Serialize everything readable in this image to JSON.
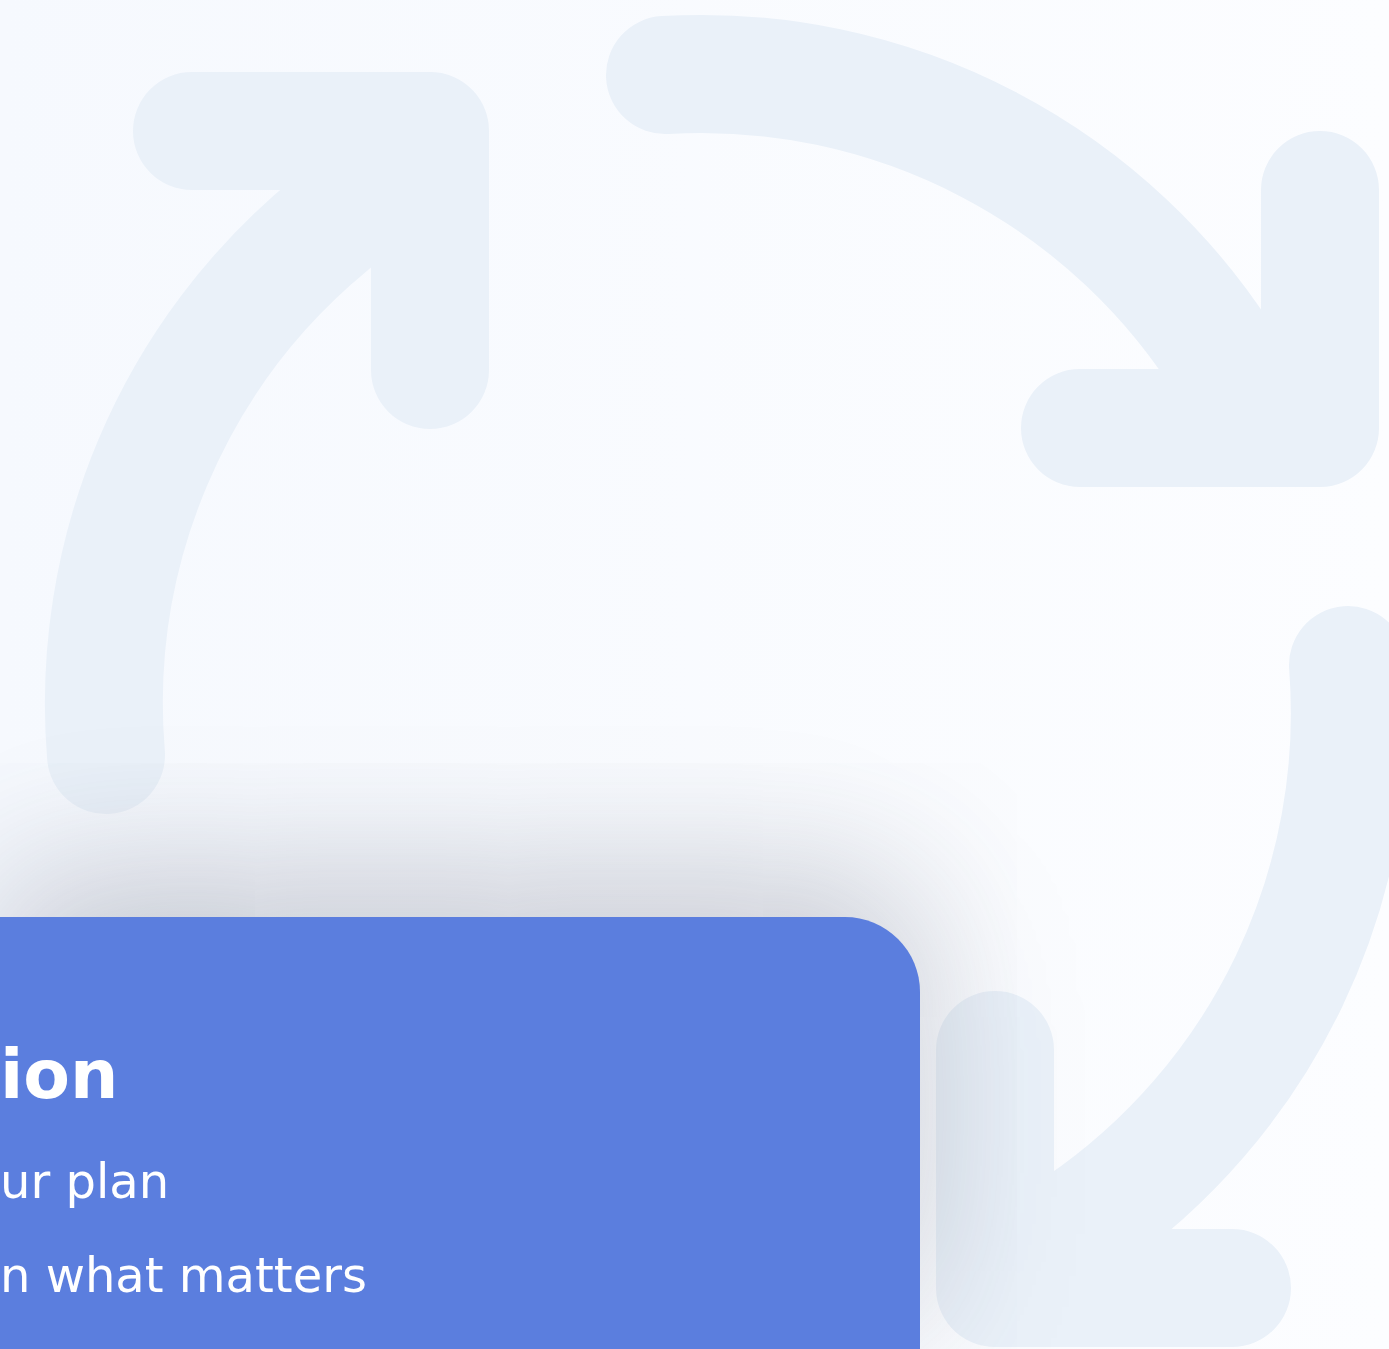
{
  "card": {
    "title": "ion",
    "lines": [
      "ur plan",
      "n what matters"
    ]
  }
}
